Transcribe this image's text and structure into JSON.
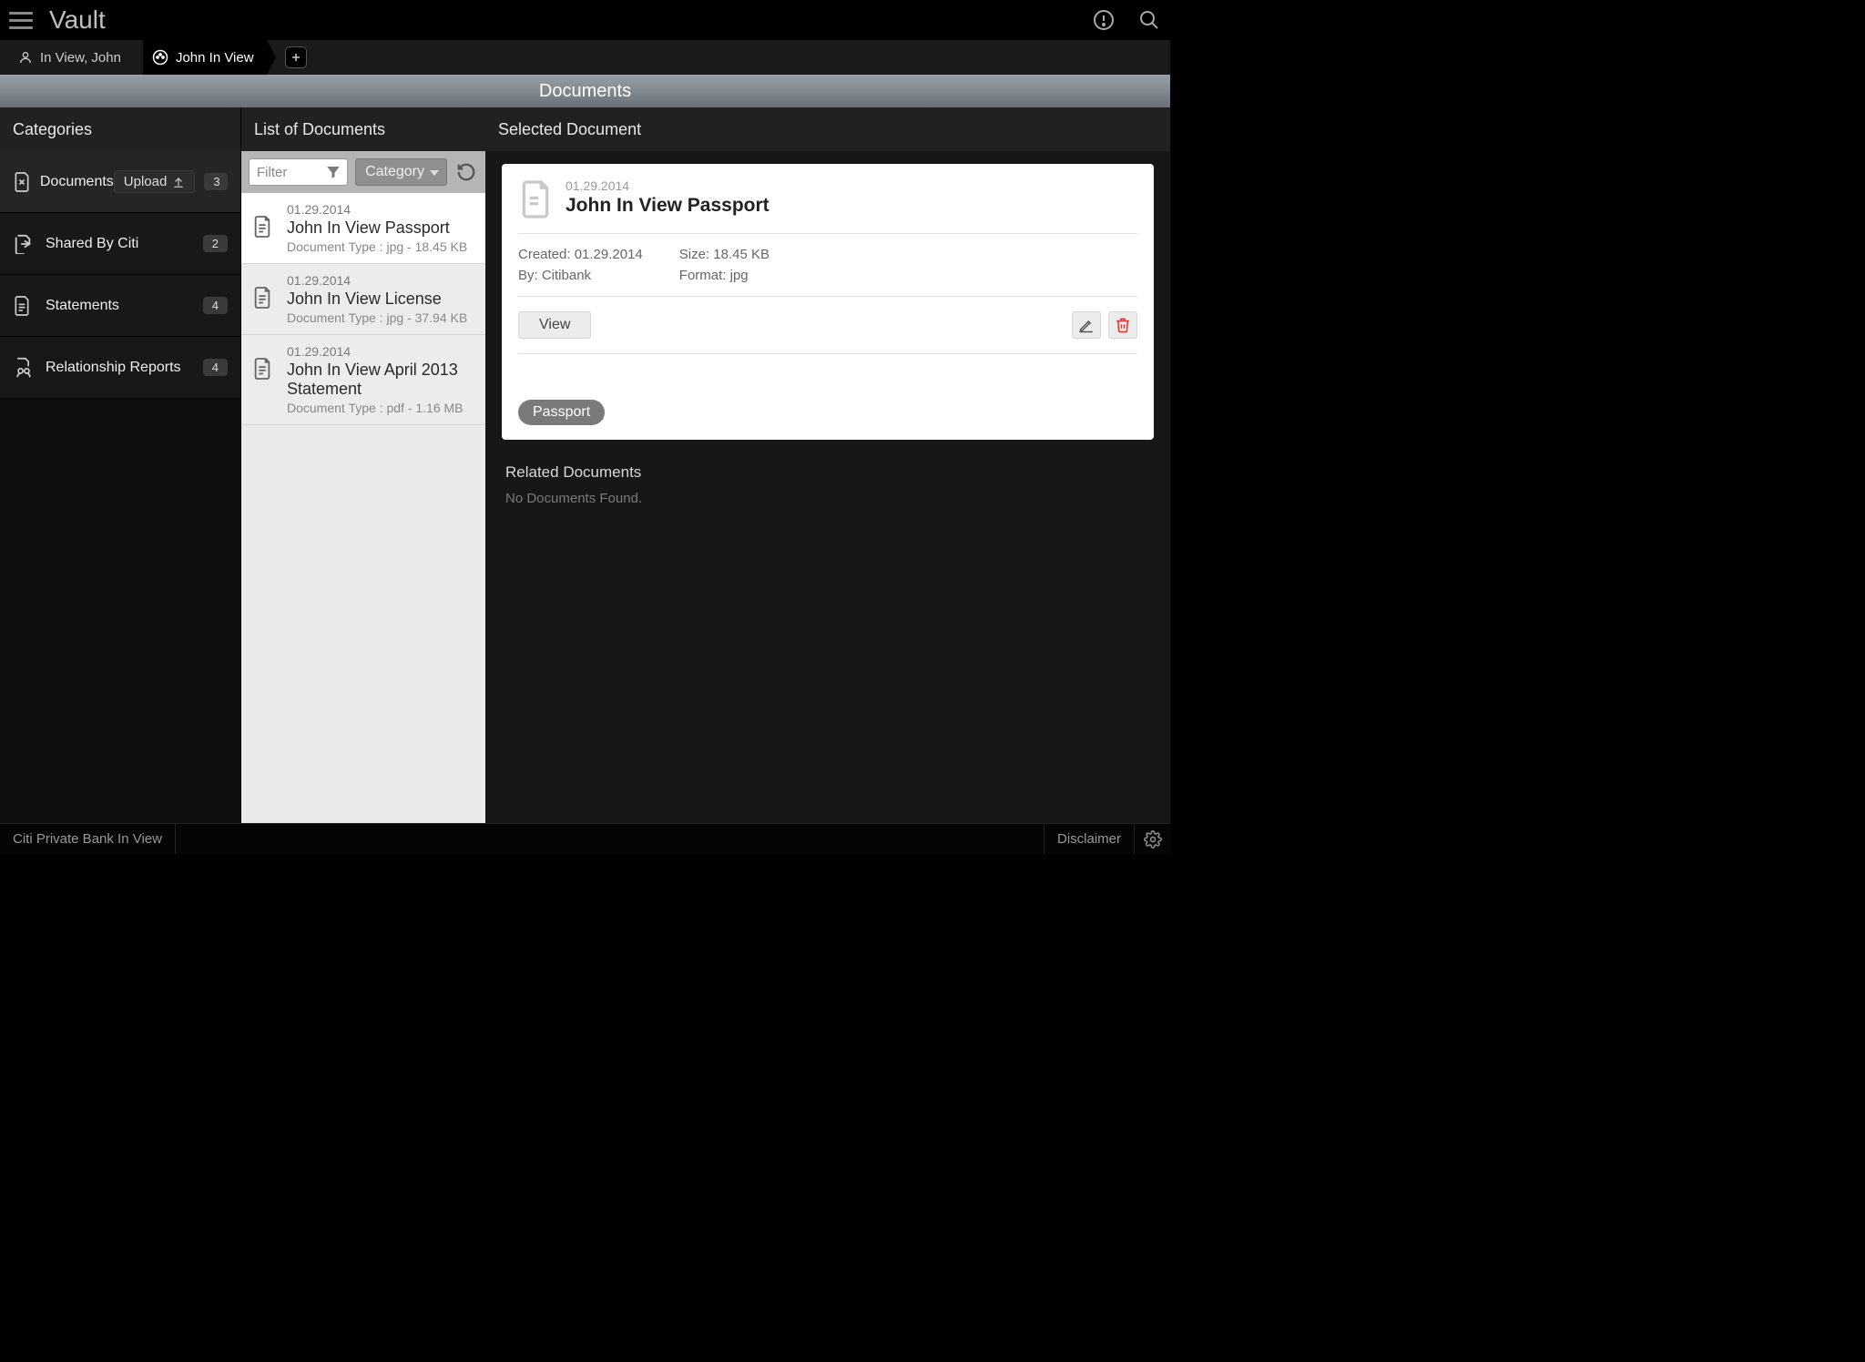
{
  "app": {
    "title": "Vault"
  },
  "breadcrumb": {
    "item0": "In View, John",
    "item1": "John   In View"
  },
  "page": {
    "title": "Documents"
  },
  "categories": {
    "title": "Categories",
    "upload_label": "Upload",
    "items": [
      {
        "label": "Documents",
        "count": "3"
      },
      {
        "label": "Shared By Citi",
        "count": "2"
      },
      {
        "label": "Statements",
        "count": "4"
      },
      {
        "label": "Relationship Reports",
        "count": "4"
      }
    ]
  },
  "list": {
    "title": "List of Documents",
    "filter_placeholder": "Filter",
    "category_label": "Category",
    "items": [
      {
        "date": "01.29.2014",
        "title": "John In View Passport",
        "meta": "Document Type : jpg - 18.45 KB"
      },
      {
        "date": "01.29.2014",
        "title": "John In View License",
        "meta": "Document Type : jpg - 37.94 KB"
      },
      {
        "date": "01.29.2014",
        "title": "John In View April 2013 Statement",
        "meta": "Document Type : pdf - 1.16 MB"
      }
    ]
  },
  "selected": {
    "title": "Selected Document",
    "card": {
      "date": "01.29.2014",
      "name": "John In View Passport",
      "created_label": "Created: 01.29.2014",
      "by_label": "By: Citibank",
      "size_label": "Size: 18.45 KB",
      "format_label": "Format: jpg",
      "view_label": "View",
      "tag": "Passport"
    },
    "related_title": "Related Documents",
    "related_empty": "No Documents Found."
  },
  "footer": {
    "brand": "Citi Private Bank In View",
    "disclaimer": "Disclaimer"
  }
}
